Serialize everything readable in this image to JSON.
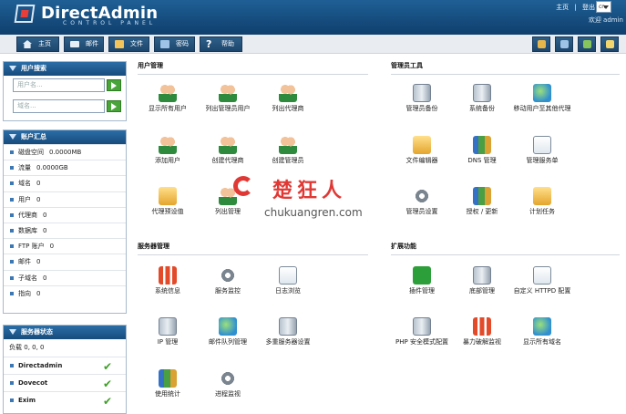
{
  "header": {
    "logo_name": "DirectAdmin",
    "logo_sub": "CONTROL PANEL",
    "top_links": [
      "主页",
      "|",
      "登出"
    ],
    "lang": "cn",
    "welcome": "欢迎 admin"
  },
  "nav": {
    "home": "主页",
    "mail": "邮件",
    "files": "文件",
    "password": "密码",
    "help": "帮助"
  },
  "left": {
    "search": {
      "title": "用户搜索",
      "user_placeholder": "用户名...",
      "domain_placeholder": "域名..."
    },
    "summary": {
      "title": "账户汇总",
      "rows": [
        {
          "label": "磁盘空间",
          "value": "0.0000MB"
        },
        {
          "label": "流量",
          "value": "0.0000GB"
        },
        {
          "label": "域名",
          "value": "0"
        },
        {
          "label": "用户",
          "value": "0"
        },
        {
          "label": "代理商",
          "value": "0"
        },
        {
          "label": "数据库",
          "value": "0"
        },
        {
          "label": "FTP 账户",
          "value": "0"
        },
        {
          "label": "邮件",
          "value": "0"
        },
        {
          "label": "子域名",
          "value": "0"
        },
        {
          "label": "指向",
          "value": "0"
        }
      ]
    },
    "server_status": {
      "title": "服务器状态",
      "load_label": "负载",
      "load_value": "0, 0, 0",
      "services": [
        "Directadmin",
        "Dovecot",
        "Exim"
      ]
    }
  },
  "sections": {
    "user_mgmt": {
      "title": "用户管理",
      "items": [
        "显示所有用户",
        "列出管理员用户",
        "列出代理商",
        "添加用户",
        "创建代理商",
        "创建管理员",
        "代理预设值",
        "列出管理"
      ]
    },
    "admin_tools": {
      "title": "管理员工具",
      "items": [
        "管理员备份",
        "系统备份",
        "移动用户至其他代理",
        "文件编辑器",
        "DNS 管理",
        "管理服务单",
        "管理员设置",
        "授权 / 更新",
        "计划任务"
      ]
    },
    "server_mgmt": {
      "title": "服务器管理",
      "items": [
        "系统信息",
        "服务监控",
        "日志浏览",
        "IP 管理",
        "邮件队列管理",
        "多重服务器设置",
        "使用统计",
        "进程监视"
      ]
    },
    "extensions": {
      "title": "扩展功能",
      "items": [
        "插件管理",
        "底部管理",
        "自定义 HTTPD 配置",
        "PHP 安全模式配置",
        "暴力破解监视",
        "显示所有域名"
      ]
    }
  },
  "watermark": {
    "chinese": "楚狂人",
    "url": "chukuangren.com"
  },
  "colors": {
    "header": "#1f5f95",
    "panel_header": "#2b6ea7",
    "ok_check": "#3ea027",
    "watermark": "#e03935"
  }
}
